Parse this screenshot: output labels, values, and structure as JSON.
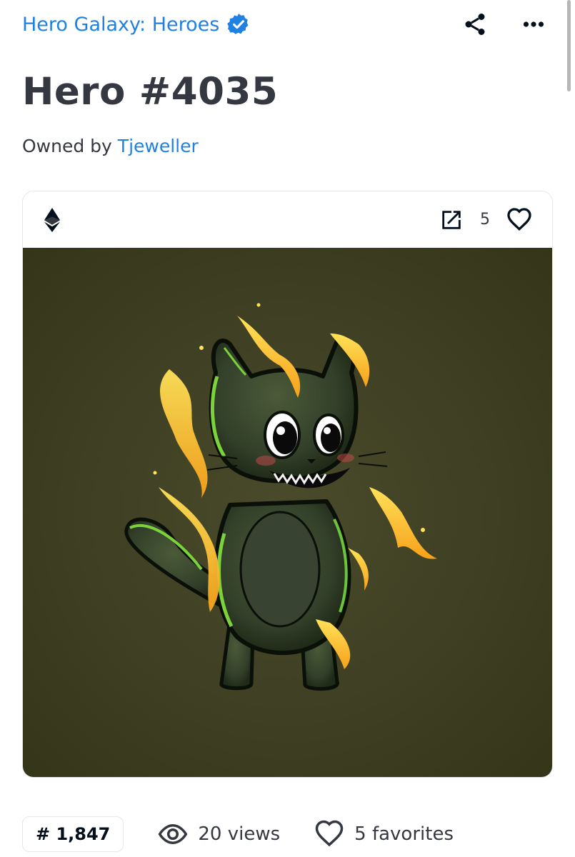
{
  "collection": {
    "name": "Hero Galaxy: Heroes",
    "verified": true,
    "accent_color": "#2081e2"
  },
  "title": "Hero #4035",
  "owner": {
    "prefix": "Owned by",
    "name": "Tjeweller"
  },
  "header_icons": [
    "share-icon",
    "more-options-icon"
  ],
  "card": {
    "chain_icon": "ethereum-icon",
    "favorite_count": "5",
    "image_alt": "Green cartoon cat character with yellow flames on an olive background",
    "background_color": "#3e3f23"
  },
  "stats": {
    "rank": "# 1,847",
    "views": "20 views",
    "favorites": "5 favorites"
  }
}
